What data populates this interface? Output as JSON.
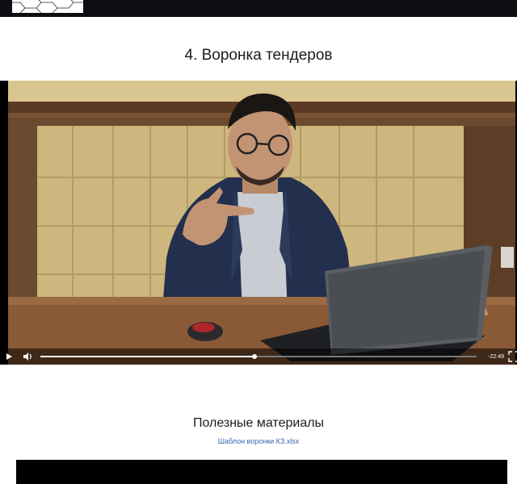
{
  "header": {
    "logo_icon": "hexagon-pattern-logo",
    "background_color": "#0d0e12"
  },
  "lesson": {
    "title": "4. Воронка тендеров"
  },
  "video": {
    "progress": 0.49,
    "time_remaining": "-22:49",
    "controls": {
      "play_icon": "play-icon",
      "volume_icon": "volume-icon",
      "fullscreen_icon": "fullscreen-icon"
    }
  },
  "materials": {
    "heading": "Полезные материалы",
    "file_link": "Шаблон воронки КЗ.xlsx",
    "link_color": "#3867b3"
  }
}
